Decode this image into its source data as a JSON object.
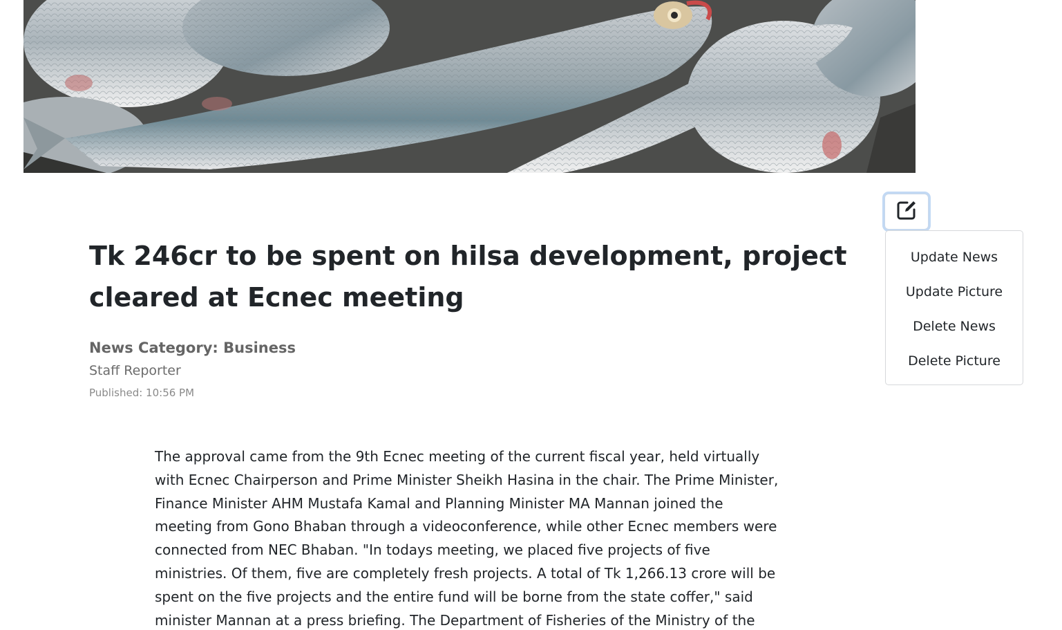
{
  "article": {
    "headline": "Tk 246cr to be spent on hilsa development, project cleared at Ecnec meeting",
    "category_label": "News Category: ",
    "category_value": "Business",
    "reporter": "Staff Reporter",
    "published_label": "Published: ",
    "published_time": "10:56 PM",
    "body": "The approval came from the 9th Ecnec meeting of the current fiscal year, held virtually with Ecnec Chairperson and Prime Minister Sheikh Hasina in the chair. The Prime Minister, Finance Minister AHM Mustafa Kamal and Planning Minister MA Mannan joined the meeting from Gono Bhaban through a videoconference, while other Ecnec members were connected from NEC Bhaban. \"In todays meeting, we placed five projects of five ministries. Of them, five are completely fresh projects. A total of Tk 1,266.13 crore will be spent on the five projects and the entire fund will be borne from the state coffer,\" said minister Mannan at a press briefing. The Department of Fisheries of the Ministry of the Fisheries and"
  },
  "actions": {
    "edit_icon": "edit-square-icon",
    "menu": [
      {
        "label": "Update News"
      },
      {
        "label": "Update Picture"
      },
      {
        "label": "Delete News"
      },
      {
        "label": "Delete Picture"
      }
    ]
  },
  "hero_image": {
    "subject": "hilsa-fish-photo"
  }
}
